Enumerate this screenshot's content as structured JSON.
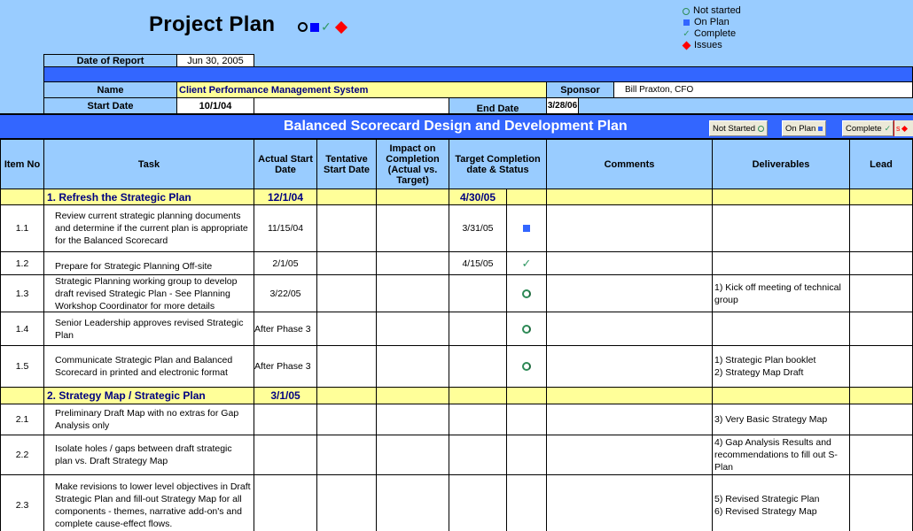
{
  "title": "Project Plan",
  "legend": [
    {
      "icon": "circle-icon",
      "label": "Not started"
    },
    {
      "icon": "square-icon",
      "label": "On Plan"
    },
    {
      "icon": "check-icon",
      "label": "Complete"
    },
    {
      "icon": "diamond-icon",
      "label": "Issues"
    }
  ],
  "report": {
    "date_label": "Date of Report",
    "date_value": "Jun 30, 2005",
    "name_label": "Name",
    "name_value": "Client Performance Management System",
    "sponsor_label": "Sponsor",
    "sponsor_value": "Bill Praxton, CFO",
    "start_label": "Start Date",
    "start_value": "10/1/04",
    "end_label": "End Date",
    "end_value": "3/28/06"
  },
  "banner": {
    "title": "Balanced Scorecard Design and Development Plan",
    "buttons": {
      "not_started": "Not Started",
      "on_plan": "On Plan",
      "complete": "Complete",
      "issues": "s"
    }
  },
  "colors": {
    "background": "#99ccff",
    "banner": "#3366ff",
    "section": "#ffff99",
    "section_text": "#000080",
    "on_plan": "#3366ff",
    "complete": "#339966",
    "not_started": "#2e8b57",
    "issues": "#ff0000"
  },
  "columns": {
    "item_no": "Item No",
    "task": "Task",
    "actual_start": "Actual Start Date",
    "tentative_start": "Tentative Start Date",
    "impact": "Impact on Completion (Actual vs. Target)",
    "target": "Target Completion date & Status",
    "comments": "Comments",
    "deliverables": "Deliverables",
    "lead": "Lead"
  },
  "sections": [
    {
      "title": "1. Refresh the Strategic Plan",
      "actual_start": "12/1/04",
      "target": "4/30/05"
    },
    {
      "title": "2. Strategy Map / Strategic Plan",
      "actual_start": "3/1/05",
      "target": ""
    }
  ],
  "rows": [
    {
      "item": "1.1",
      "task": "Review current strategic planning documents and determine if the current plan is appropriate for the Balanced Scorecard",
      "actual_start": "11/15/04",
      "target": "3/31/05",
      "status": "on-plan",
      "deliverables": ""
    },
    {
      "item": "1.2",
      "task": "Prepare for Strategic Planning Off-site",
      "actual_start": "2/1/05",
      "target": "4/15/05",
      "status": "complete",
      "deliverables": ""
    },
    {
      "item": "1.3",
      "task": "Strategic Planning working group to develop draft revised Strategic Plan - See Planning Workshop Coordinator for more details",
      "actual_start": "3/22/05",
      "target": "",
      "status": "not-started",
      "deliverables": "1) Kick off meeting of technical group"
    },
    {
      "item": "1.4",
      "task": "Senior Leadership approves revised Strategic Plan",
      "actual_start": "After Phase 3",
      "target": "",
      "status": "not-started",
      "deliverables": ""
    },
    {
      "item": "1.5",
      "task": "Communicate Strategic Plan and Balanced Scorecard in printed and electronic format",
      "actual_start": "After Phase 3",
      "target": "",
      "status": "not-started",
      "deliverables": "1) Strategic Plan booklet\n2) Strategy Map Draft"
    },
    {
      "item": "2.1",
      "task": "Preliminary Draft Map with no extras for Gap Analysis only",
      "actual_start": "",
      "target": "",
      "status": "",
      "deliverables": "3) Very Basic Strategy Map"
    },
    {
      "item": "2.2",
      "task": "Isolate holes / gaps between draft strategic plan vs. Draft Strategy Map",
      "actual_start": "",
      "target": "",
      "status": "",
      "deliverables": "4) Gap Analysis Results and recommendations to fill out S-Plan"
    },
    {
      "item": "2.3",
      "task": "Make revisions to lower level objectives in Draft Strategic Plan and fill-out Strategy Map for all components - themes, narrative add-on's and complete cause-effect flows.",
      "actual_start": "",
      "target": "",
      "status": "",
      "deliverables": "5) Revised Strategic Plan\n6) Revised Strategy Map"
    }
  ]
}
